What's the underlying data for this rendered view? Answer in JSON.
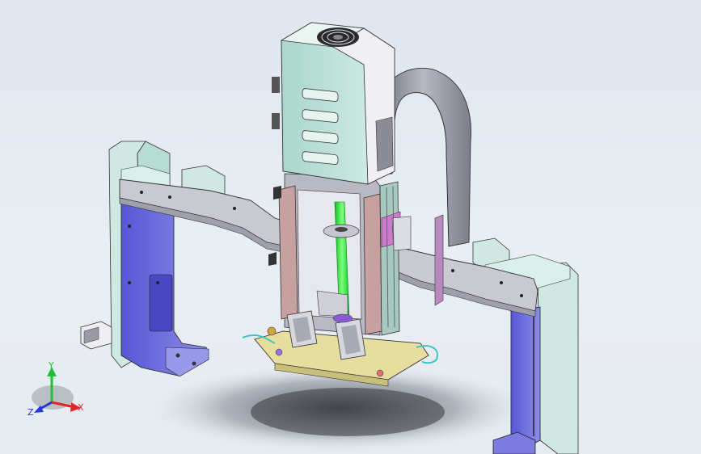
{
  "triad": {
    "x_label": "X",
    "y_label": "Y",
    "z_label": "Z",
    "x_color": "#e0262b",
    "y_color": "#1fbf3a",
    "z_color": "#2636d9"
  },
  "colors": {
    "frame_mint": "#cfe8e2",
    "frame_blue": "#6f6fe0",
    "beam_grey": "#c9c9d2",
    "enclosure": "#bfe3da",
    "cable_chain": "#8b8c96",
    "slide_pink": "#c7a0a0",
    "rod_green": "#26e03a",
    "tray_yellow": "#e6de9e"
  },
  "icons": [
    "coordinate-triad-icon",
    "cooling-fan-icon"
  ]
}
